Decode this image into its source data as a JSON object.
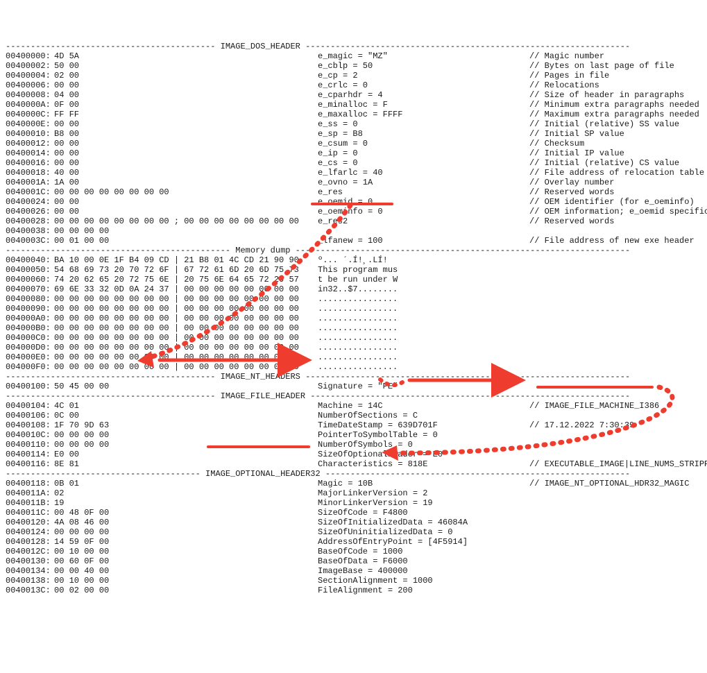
{
  "sections": {
    "dos_header": "IMAGE_DOS_HEADER",
    "memory_dump": "Memory dump",
    "nt_headers": "IMAGE_NT_HEADERS",
    "file_header": "IMAGE_FILE_HEADER",
    "optional_header": "IMAGE_OPTIONAL_HEADER32"
  },
  "rows": [
    {
      "addr": "00400000:",
      "hex": "4D 5A",
      "field": "e_magic = \"MZ\"",
      "comment": "// Magic number"
    },
    {
      "addr": "00400002:",
      "hex": "50 00",
      "field": "e_cblp = 50",
      "comment": "// Bytes on last page of file"
    },
    {
      "addr": "00400004:",
      "hex": "02 00",
      "field": "e_cp = 2",
      "comment": "// Pages in file"
    },
    {
      "addr": "00400006:",
      "hex": "00 00",
      "field": "e_crlc = 0",
      "comment": "// Relocations"
    },
    {
      "addr": "00400008:",
      "hex": "04 00",
      "field": "e_cparhdr = 4",
      "comment": "// Size of header in paragraphs"
    },
    {
      "addr": "0040000A:",
      "hex": "0F 00",
      "field": "e_minalloc = F",
      "comment": "// Minimum extra paragraphs needed"
    },
    {
      "addr": "0040000C:",
      "hex": "FF FF",
      "field": "e_maxalloc = FFFF",
      "comment": "// Maximum extra paragraphs needed"
    },
    {
      "addr": "0040000E:",
      "hex": "00 00",
      "field": "e_ss = 0",
      "comment": "// Initial (relative) SS value"
    },
    {
      "addr": "00400010:",
      "hex": "B8 00",
      "field": "e_sp = B8",
      "comment": "// Initial SP value"
    },
    {
      "addr": "00400012:",
      "hex": "00 00",
      "field": "e_csum = 0",
      "comment": "// Checksum"
    },
    {
      "addr": "00400014:",
      "hex": "00 00",
      "field": "e_ip = 0",
      "comment": "// Initial IP value"
    },
    {
      "addr": "00400016:",
      "hex": "00 00",
      "field": "e_cs = 0",
      "comment": "// Initial (relative) CS value"
    },
    {
      "addr": "00400018:",
      "hex": "40 00",
      "field": "e_lfarlc = 40",
      "comment": "// File address of relocation table"
    },
    {
      "addr": "0040001A:",
      "hex": "1A 00",
      "field": "e_ovno = 1A",
      "comment": "// Overlay number"
    },
    {
      "addr": "0040001C:",
      "hex": "00 00 00 00 00 00 00 00",
      "field": "e_res",
      "comment": "// Reserved words"
    },
    {
      "addr": "00400024:",
      "hex": "00 00",
      "field": "e_oemid = 0",
      "comment": "// OEM identifier (for e_oeminfo)"
    },
    {
      "addr": "00400026:",
      "hex": "00 00",
      "field": "e_oeminfo = 0",
      "comment": "// OEM information; e_oemid specific"
    },
    {
      "addr": "00400028:",
      "hex": "00 00 00 00 00 00 00 00 ; 00 00 00 00 00 00 00 00",
      "field": "e_res2",
      "comment": "// Reserved words"
    },
    {
      "addr": "00400038:",
      "hex": "00 00 00 00",
      "field": "",
      "comment": ""
    },
    {
      "addr": "0040003C:",
      "hex": "00 01 00 00",
      "field": "_lfanew = 100",
      "comment": "// File address of new exe header"
    }
  ],
  "memrows": [
    {
      "addr": "00400040:",
      "hex": "BA 10 00 0E 1F B4 09 CD | 21 B8 01 4C CD 21 90 90",
      "ascii": "º... ´.Í!¸.LÍ!"
    },
    {
      "addr": "00400050:",
      "hex": "54 68 69 73 20 70 72 6F | 67 72 61 6D 20 6D 75 73",
      "ascii": "This program mus"
    },
    {
      "addr": "00400060:",
      "hex": "74 20 62 65 20 72 75 6E | 20 75 6E 64 65 72 20 57",
      "ascii": "t be run under W"
    },
    {
      "addr": "00400070:",
      "hex": "69 6E 33 32 0D 0A 24 37 | 00 00 00 00 00 00 00 00",
      "ascii": "in32..$7........"
    },
    {
      "addr": "00400080:",
      "hex": "00 00 00 00 00 00 00 00 | 00 00 00 00 00 00 00 00",
      "ascii": "................"
    },
    {
      "addr": "00400090:",
      "hex": "00 00 00 00 00 00 00 00 | 00 00 00 00 00 00 00 00",
      "ascii": "................"
    },
    {
      "addr": "004000A0:",
      "hex": "00 00 00 00 00 00 00 00 | 00 00 00 00 00 00 00 00",
      "ascii": "................"
    },
    {
      "addr": "004000B0:",
      "hex": "00 00 00 00 00 00 00 00 | 00 00 00 00 00 00 00 00",
      "ascii": "................"
    },
    {
      "addr": "004000C0:",
      "hex": "00 00 00 00 00 00 00 00 | 00 00 00 00 00 00 00 00",
      "ascii": "................"
    },
    {
      "addr": "004000D0:",
      "hex": "00 00 00 00 00 00 00 00 | 00 00 00 00 00 00 00 00",
      "ascii": "................"
    },
    {
      "addr": "004000E0:",
      "hex": "00 00 00 00 00 00 00 00 | 00 00 00 00 00 00 00 00",
      "ascii": "................"
    },
    {
      "addr": "004000F0:",
      "hex": "00 00 00 00 00 00 00 00 | 00 00 00 00 00 00 00 00",
      "ascii": "................"
    }
  ],
  "ntrow": {
    "addr": "00400100:",
    "hex": "50 45 00 00",
    "field": "Signature = \"PE\"",
    "comment": ""
  },
  "filerows": [
    {
      "addr": "00400104:",
      "hex": "4C 01",
      "field": "Machine = 14C",
      "comment": "// IMAGE_FILE_MACHINE_I386"
    },
    {
      "addr": "00400106:",
      "hex": "0C 00",
      "field": "NumberOfSections = C",
      "comment": ""
    },
    {
      "addr": "00400108:",
      "hex": "1F 70 9D 63",
      "field": "TimeDateStamp = 639D701F",
      "comment": "// 17.12.2022 7:30:39"
    },
    {
      "addr": "0040010C:",
      "hex": "00 00 00 00",
      "field": "PointerToSymbolTable = 0",
      "comment": ""
    },
    {
      "addr": "00400110:",
      "hex": "00 00 00 00",
      "field": "NumberOfSymbols = 0",
      "comment": ""
    },
    {
      "addr": "00400114:",
      "hex": "E0 00",
      "field": "SizeOfOptionalHeader = E0",
      "comment": ""
    },
    {
      "addr": "00400116:",
      "hex": "8E 81",
      "field": "Characteristics = 818E",
      "comment": "// EXECUTABLE_IMAGE|LINE_NUMS_STRIPPED"
    }
  ],
  "optrows": [
    {
      "addr": "00400118:",
      "hex": "0B 01",
      "field": "Magic = 10B",
      "comment": "// IMAGE_NT_OPTIONAL_HDR32_MAGIC"
    },
    {
      "addr": "0040011A:",
      "hex": "02",
      "field": "MajorLinkerVersion = 2",
      "comment": ""
    },
    {
      "addr": "0040011B:",
      "hex": "19",
      "field": "MinorLinkerVersion = 19",
      "comment": ""
    },
    {
      "addr": "0040011C:",
      "hex": "00 48 0F 00",
      "field": "SizeOfCode = F4800",
      "comment": ""
    },
    {
      "addr": "00400120:",
      "hex": "4A 08 46 00",
      "field": "SizeOfInitializedData = 46084A",
      "comment": ""
    },
    {
      "addr": "00400124:",
      "hex": "00 00 00 00",
      "field": "SizeOfUninitializedData = 0",
      "comment": ""
    },
    {
      "addr": "00400128:",
      "hex": "14 59 0F 00",
      "field": "AddressOfEntryPoint = [4F5914]",
      "comment": ""
    },
    {
      "addr": "0040012C:",
      "hex": "00 10 00 00",
      "field": "BaseOfCode = 1000",
      "comment": ""
    },
    {
      "addr": "00400130:",
      "hex": "00 60 0F 00",
      "field": "BaseOfData = F6000",
      "comment": ""
    },
    {
      "addr": "00400134:",
      "hex": "00 00 40 00",
      "field": "ImageBase = 400000",
      "comment": ""
    },
    {
      "addr": "00400138:",
      "hex": "00 10 00 00",
      "field": "SectionAlignment = 1000",
      "comment": ""
    },
    {
      "addr": "0040013C:",
      "hex": "00 02 00 00",
      "field": "FileAlignment = 200",
      "comment": ""
    }
  ],
  "annotations": {
    "red": "#EE3C2E"
  }
}
